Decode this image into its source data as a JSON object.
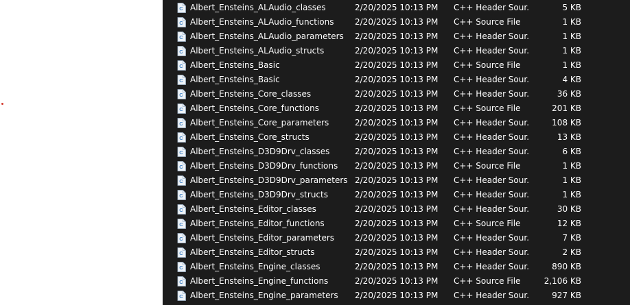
{
  "colors": {
    "list_background": "#1c1c1c",
    "text": "#ffffff",
    "icon_page": "#eef3f8",
    "icon_accent": "#3b7fc4"
  },
  "file_icon": "cpp-file-icon",
  "files": [
    {
      "name": "Albert_Ensteins_ALAudio_classes",
      "date": "2/20/2025 10:13 PM",
      "type": "C++ Header Sour...",
      "size": "5 KB"
    },
    {
      "name": "Albert_Ensteins_ALAudio_functions",
      "date": "2/20/2025 10:13 PM",
      "type": "C++ Source File",
      "size": "1 KB"
    },
    {
      "name": "Albert_Ensteins_ALAudio_parameters",
      "date": "2/20/2025 10:13 PM",
      "type": "C++ Header Sour...",
      "size": "1 KB"
    },
    {
      "name": "Albert_Ensteins_ALAudio_structs",
      "date": "2/20/2025 10:13 PM",
      "type": "C++ Header Sour...",
      "size": "1 KB"
    },
    {
      "name": "Albert_Ensteins_Basic",
      "date": "2/20/2025 10:13 PM",
      "type": "C++ Source File",
      "size": "1 KB"
    },
    {
      "name": "Albert_Ensteins_Basic",
      "date": "2/20/2025 10:13 PM",
      "type": "C++ Header Sour...",
      "size": "4 KB"
    },
    {
      "name": "Albert_Ensteins_Core_classes",
      "date": "2/20/2025 10:13 PM",
      "type": "C++ Header Sour...",
      "size": "36 KB"
    },
    {
      "name": "Albert_Ensteins_Core_functions",
      "date": "2/20/2025 10:13 PM",
      "type": "C++ Source File",
      "size": "201 KB"
    },
    {
      "name": "Albert_Ensteins_Core_parameters",
      "date": "2/20/2025 10:13 PM",
      "type": "C++ Header Sour...",
      "size": "108 KB"
    },
    {
      "name": "Albert_Ensteins_Core_structs",
      "date": "2/20/2025 10:13 PM",
      "type": "C++ Header Sour...",
      "size": "13 KB"
    },
    {
      "name": "Albert_Ensteins_D3D9Drv_classes",
      "date": "2/20/2025 10:13 PM",
      "type": "C++ Header Sour...",
      "size": "6 KB"
    },
    {
      "name": "Albert_Ensteins_D3D9Drv_functions",
      "date": "2/20/2025 10:13 PM",
      "type": "C++ Source File",
      "size": "1 KB"
    },
    {
      "name": "Albert_Ensteins_D3D9Drv_parameters",
      "date": "2/20/2025 10:13 PM",
      "type": "C++ Header Sour...",
      "size": "1 KB"
    },
    {
      "name": "Albert_Ensteins_D3D9Drv_structs",
      "date": "2/20/2025 10:13 PM",
      "type": "C++ Header Sour...",
      "size": "1 KB"
    },
    {
      "name": "Albert_Ensteins_Editor_classes",
      "date": "2/20/2025 10:13 PM",
      "type": "C++ Header Sour...",
      "size": "30 KB"
    },
    {
      "name": "Albert_Ensteins_Editor_functions",
      "date": "2/20/2025 10:13 PM",
      "type": "C++ Source File",
      "size": "12 KB"
    },
    {
      "name": "Albert_Ensteins_Editor_parameters",
      "date": "2/20/2025 10:13 PM",
      "type": "C++ Header Sour...",
      "size": "7 KB"
    },
    {
      "name": "Albert_Ensteins_Editor_structs",
      "date": "2/20/2025 10:13 PM",
      "type": "C++ Header Sour...",
      "size": "2 KB"
    },
    {
      "name": "Albert_Ensteins_Engine_classes",
      "date": "2/20/2025 10:13 PM",
      "type": "C++ Header Sour...",
      "size": "890 KB"
    },
    {
      "name": "Albert_Ensteins_Engine_functions",
      "date": "2/20/2025 10:13 PM",
      "type": "C++ Source File",
      "size": "2,106 KB"
    },
    {
      "name": "Albert_Ensteins_Engine_parameters",
      "date": "2/20/2025 10:13 PM",
      "type": "C++ Header Sour...",
      "size": "927 KB"
    }
  ]
}
